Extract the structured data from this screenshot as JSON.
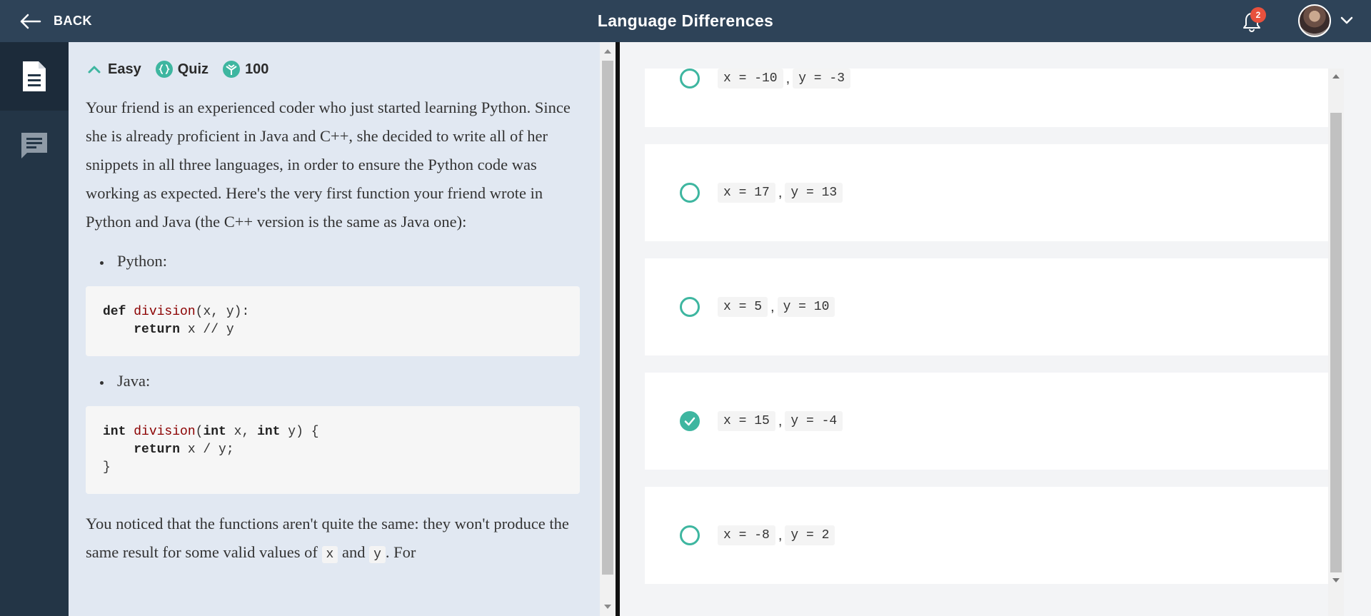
{
  "header": {
    "back_label": "BACK",
    "title": "Language Differences",
    "notification_count": "2"
  },
  "sidebar": {
    "items": [
      {
        "name": "description",
        "icon": "document-icon",
        "active": true
      },
      {
        "name": "comments",
        "icon": "comment-icon",
        "active": false
      }
    ]
  },
  "task": {
    "difficulty": "Easy",
    "type": "Quiz",
    "points": "100",
    "intro": "Your friend is an experienced coder who just started learning Python. Since she is already proficient in Java and C++, she decided to write all of her snippets in all three languages, in order to ensure the Python code was working as expected. Here's the very first function your friend wrote in Python and Java (the C++ version is the same as Java one):",
    "python_label": "Python:",
    "python_code": {
      "line1_kw": "def",
      "line1_fn": "division",
      "line1_rest": "(x, y):",
      "line2_indent": "    ",
      "line2_kw": "return",
      "line2_rest": " x // y"
    },
    "java_label": "Java:",
    "java_code": {
      "line1_kw": "int",
      "line1_fn": "division",
      "line1_p1": "(",
      "line1_kw2": "int",
      "line1_p2": " x, ",
      "line1_kw3": "int",
      "line1_p3": " y) {",
      "line2_indent": "    ",
      "line2_kw": "return",
      "line2_rest": " x / y;",
      "line3": "}"
    },
    "outro_1": "You noticed that the functions aren't quite the same: they won't produce the same result for some valid values of ",
    "outro_var_x": "x",
    "outro_and": " and ",
    "outro_var_y": "y",
    "outro_2": ". For"
  },
  "options": [
    {
      "x": "x = -10",
      "sep": ",",
      "y": "y = -3",
      "selected": false
    },
    {
      "x": "x = 17",
      "sep": ",",
      "y": "y = 13",
      "selected": false
    },
    {
      "x": "x = 5",
      "sep": ",",
      "y": "y = 10",
      "selected": false
    },
    {
      "x": "x = 15",
      "sep": ",",
      "y": "y = -4",
      "selected": true
    },
    {
      "x": "x = -8",
      "sep": ",",
      "y": "y = 2",
      "selected": false
    }
  ],
  "colors": {
    "topbar": "#2e4358",
    "accent": "#3eb6a0",
    "badge": "#e8513d"
  }
}
